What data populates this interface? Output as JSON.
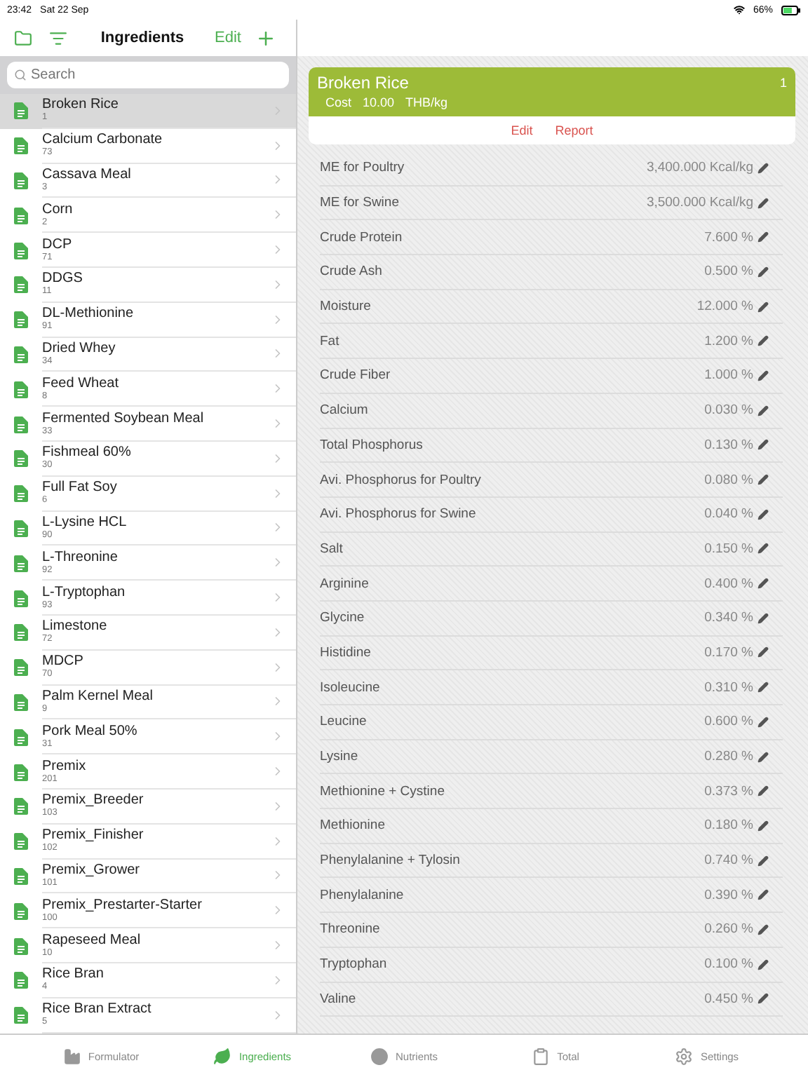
{
  "status_bar": {
    "time": "23:42",
    "date": "Sat 22 Sep",
    "battery": "66%"
  },
  "nav_bar": {
    "title": "Ingredients",
    "edit": "Edit"
  },
  "search": {
    "placeholder": "Search"
  },
  "ingredients": [
    {
      "name": "Broken Rice",
      "code": "1",
      "selected": true
    },
    {
      "name": "Calcium Carbonate",
      "code": "73",
      "selected": false
    },
    {
      "name": "Cassava Meal",
      "code": "3",
      "selected": false
    },
    {
      "name": "Corn",
      "code": "2",
      "selected": false
    },
    {
      "name": "DCP",
      "code": "71",
      "selected": false
    },
    {
      "name": "DDGS",
      "code": "11",
      "selected": false
    },
    {
      "name": "DL-Methionine",
      "code": "91",
      "selected": false
    },
    {
      "name": "Dried Whey",
      "code": "34",
      "selected": false
    },
    {
      "name": "Feed Wheat",
      "code": "8",
      "selected": false
    },
    {
      "name": "Fermented Soybean Meal",
      "code": "33",
      "selected": false
    },
    {
      "name": "Fishmeal 60%",
      "code": "30",
      "selected": false
    },
    {
      "name": "Full Fat Soy",
      "code": "6",
      "selected": false
    },
    {
      "name": "L-Lysine HCL",
      "code": "90",
      "selected": false
    },
    {
      "name": "L-Threonine",
      "code": "92",
      "selected": false
    },
    {
      "name": "L-Tryptophan",
      "code": "93",
      "selected": false
    },
    {
      "name": "Limestone",
      "code": "72",
      "selected": false
    },
    {
      "name": "MDCP",
      "code": "70",
      "selected": false
    },
    {
      "name": "Palm Kernel Meal",
      "code": "9",
      "selected": false
    },
    {
      "name": "Pork Meal 50%",
      "code": "31",
      "selected": false
    },
    {
      "name": "Premix",
      "code": "201",
      "selected": false
    },
    {
      "name": "Premix_Breeder",
      "code": "103",
      "selected": false
    },
    {
      "name": "Premix_Finisher",
      "code": "102",
      "selected": false
    },
    {
      "name": "Premix_Grower",
      "code": "101",
      "selected": false
    },
    {
      "name": "Premix_Prestarter-Starter",
      "code": "100",
      "selected": false
    },
    {
      "name": "Rapeseed Meal",
      "code": "10",
      "selected": false
    },
    {
      "name": "Rice Bran",
      "code": "4",
      "selected": false
    },
    {
      "name": "Rice Bran Extract",
      "code": "5",
      "selected": false
    }
  ],
  "detail": {
    "name": "Broken Rice",
    "code": "1",
    "cost_label": "Cost",
    "cost": "10.00",
    "unit": "THB/kg",
    "actions": [
      "Edit",
      "Report"
    ]
  },
  "nutrients": [
    {
      "name": "ME for Poultry",
      "value": "3,400.000 Kcal/kg"
    },
    {
      "name": "ME for Swine",
      "value": "3,500.000 Kcal/kg"
    },
    {
      "name": "Crude Protein",
      "value": "7.600 %"
    },
    {
      "name": "Crude Ash",
      "value": "0.500 %"
    },
    {
      "name": "Moisture",
      "value": "12.000 %"
    },
    {
      "name": "Fat",
      "value": "1.200 %"
    },
    {
      "name": "Crude Fiber",
      "value": "1.000 %"
    },
    {
      "name": "Calcium",
      "value": "0.030 %"
    },
    {
      "name": "Total Phosphorus",
      "value": "0.130 %"
    },
    {
      "name": "Avi. Phosphorus for Poultry",
      "value": "0.080 %"
    },
    {
      "name": "Avi. Phosphorus for Swine",
      "value": "0.040 %"
    },
    {
      "name": "Salt",
      "value": "0.150 %"
    },
    {
      "name": "Arginine",
      "value": "0.400 %"
    },
    {
      "name": "Glycine",
      "value": "0.340 %"
    },
    {
      "name": "Histidine",
      "value": "0.170 %"
    },
    {
      "name": "Isoleucine",
      "value": "0.310 %"
    },
    {
      "name": "Leucine",
      "value": "0.600 %"
    },
    {
      "name": "Lysine",
      "value": "0.280 %"
    },
    {
      "name": "Methionine + Cystine",
      "value": "0.373 %"
    },
    {
      "name": "Methionine",
      "value": "0.180 %"
    },
    {
      "name": "Phenylalanine + Tylosin",
      "value": "0.740 %"
    },
    {
      "name": "Phenylalanine",
      "value": "0.390 %"
    },
    {
      "name": "Threonine",
      "value": "0.260 %"
    },
    {
      "name": "Tryptophan",
      "value": "0.100 %"
    },
    {
      "name": "Valine",
      "value": "0.450 %"
    }
  ],
  "tab_bar": [
    {
      "label": "Formulator",
      "kind": "factory",
      "selected": false
    },
    {
      "label": "Ingredients",
      "kind": "leaf",
      "selected": true
    },
    {
      "label": "Nutrients",
      "kind": "circle",
      "selected": false
    },
    {
      "label": "Total",
      "kind": "clipboard",
      "selected": false
    },
    {
      "label": "Settings",
      "kind": "gear",
      "selected": false
    }
  ]
}
